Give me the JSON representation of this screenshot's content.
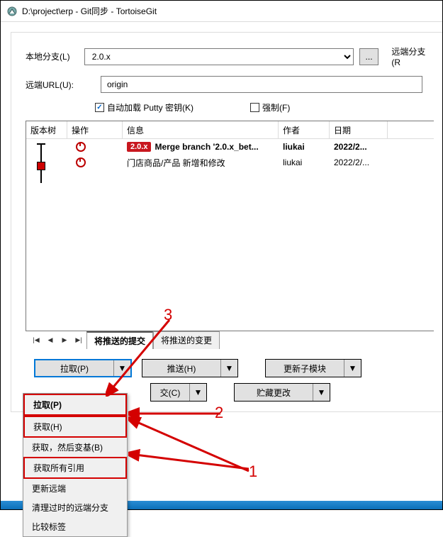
{
  "window": {
    "title": "D:\\project\\erp - Git同步 - TortoiseGit"
  },
  "form": {
    "local_branch_label": "本地分支(L)",
    "local_branch_value": "2.0.x",
    "ellipsis": "...",
    "remote_branch_label": "远端分支(R",
    "remote_url_label": "远端URL(U):",
    "remote_url_value": "origin",
    "autoload_putty": {
      "checked": true,
      "label": "自动加载 Putty 密钥(K)"
    },
    "force": {
      "checked": false,
      "label": "强制(F)"
    }
  },
  "columns": {
    "tree": "版本树",
    "op": "操作",
    "info": "信息",
    "author": "作者",
    "date": "日期"
  },
  "rows": [
    {
      "badge": "2.0.x",
      "info": "Merge branch '2.0.x_bet...",
      "author": "liukai",
      "date": "2022/2...",
      "bold": true
    },
    {
      "badge": "",
      "info": "门店商品/产品 新增和修改",
      "author": "liukai",
      "date": "2022/2/...",
      "bold": false
    }
  ],
  "tabs": {
    "active": "将推送的提交",
    "inactive": "将推送的变更"
  },
  "buttons": {
    "pull": "拉取(P)",
    "push": "推送(H)",
    "submodule": "更新子模块",
    "commit_suffix": "交(C)",
    "stash": "贮藏更改"
  },
  "menu": {
    "items": [
      {
        "label": "拉取(P)",
        "highlight": true,
        "bold": true
      },
      {
        "label": "获取(H)",
        "highlight": true,
        "bold": false
      },
      {
        "label": "获取，然后变基(B)",
        "highlight": false,
        "bold": false
      },
      {
        "label": "获取所有引用",
        "highlight": true,
        "bold": false
      },
      {
        "label": "更新远端",
        "highlight": false,
        "bold": false
      },
      {
        "label": "清理过时的远端分支",
        "highlight": false,
        "bold": false
      },
      {
        "label": "比较标签",
        "highlight": false,
        "bold": false
      }
    ]
  },
  "annot": {
    "n1": "1",
    "n2": "2",
    "n3": "3"
  },
  "dropdown_arrow": "▼"
}
